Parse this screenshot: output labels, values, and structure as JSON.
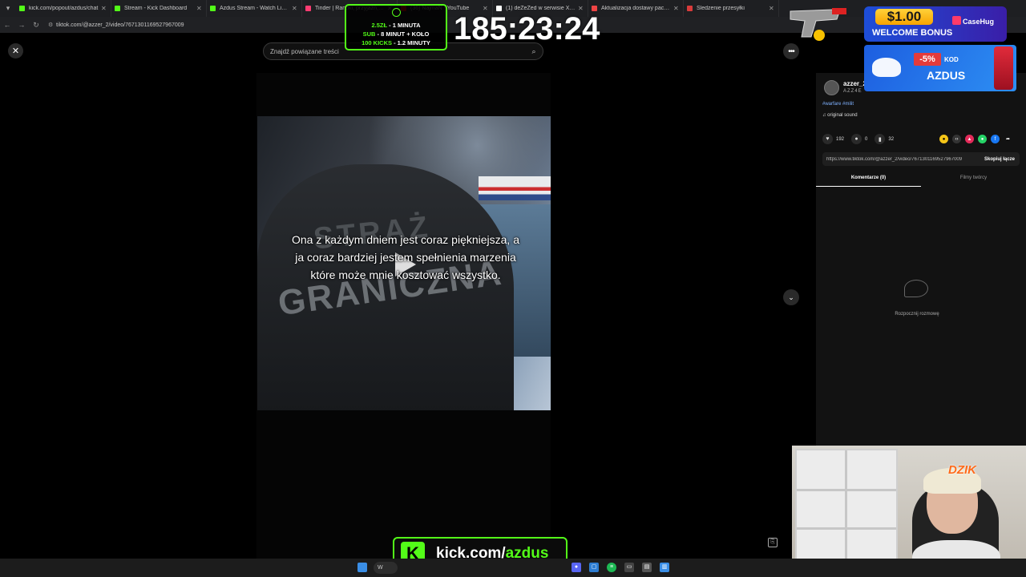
{
  "browser": {
    "tabs": [
      {
        "title": "kick.com/popout/azdus/chat",
        "color": "#53fc18"
      },
      {
        "title": "Stream - Kick Dashboard",
        "color": "#53fc18"
      },
      {
        "title": "Azdus Stream - Watch Live on K",
        "color": "#53fc18"
      },
      {
        "title": "Tinder | Randki, przyjaźń, nowe",
        "color": "#fe3c72"
      },
      {
        "title": "(36) NajmaN - YouTube",
        "color": "#ff0000"
      },
      {
        "title": "(1) deZeZed w serwisie X: „Ran",
        "color": "#ffffff"
      },
      {
        "title": "Aktualizacja dostawy paczek",
        "color": "#e44"
      },
      {
        "title": "Śledzenie przesyłki",
        "color": "#d93b3b"
      }
    ],
    "url": "tiktok.com/@azzer_2/video/7671301169527967009"
  },
  "page": {
    "search_placeholder": "Znajdź powiązane treści",
    "caption": "Ona z każdym dniem jest coraz piękniejsza, a ja coraz bardziej jestem spełnienia marzenia które może mnie kosztować wszystko.",
    "video_text_1": "STRAŻ",
    "video_text_2": "GRANICZNA"
  },
  "panel": {
    "author_name": "azzer_2",
    "author_id": "AZZ4E",
    "hashtags": "#warfare #milit",
    "music": "♫ original sound",
    "likes": "192",
    "comments": "0",
    "saves": "32",
    "link": "https://www.tiktok.com/@azzer_2/video/7671301169527967009",
    "copy_label": "Skopiuj łącze",
    "tabs": [
      "Komentarze (0)",
      "Filmy twórcy"
    ],
    "empty_text": "Rozpocznij rozmowę"
  },
  "overlay": {
    "alert_line1_a": "2.5ZŁ",
    "alert_line1_b": " - 1 MINUTA",
    "alert_line2_a": "SUB",
    "alert_line2_b": " - 8 MINUT + KOŁO",
    "alert_line3_a": "100 KICKS",
    "alert_line3_b": " - 1.2 MINUTY",
    "timer": "185:23:24",
    "bonus_amount": "$1.00",
    "bonus_text": "WELCOME BONUS",
    "bonus_brand": "CaseHug",
    "promo_percent": "-5%",
    "promo_kod": "KOD",
    "promo_code": "AZDUS",
    "kick_url_a": "kick.com/",
    "kick_url_b": "azdus",
    "webcam_logo": "DZIK"
  },
  "taskbar": {
    "search_label": "W"
  },
  "colors": {
    "kick_green": "#53fc18",
    "panel_bg": "#121212"
  }
}
